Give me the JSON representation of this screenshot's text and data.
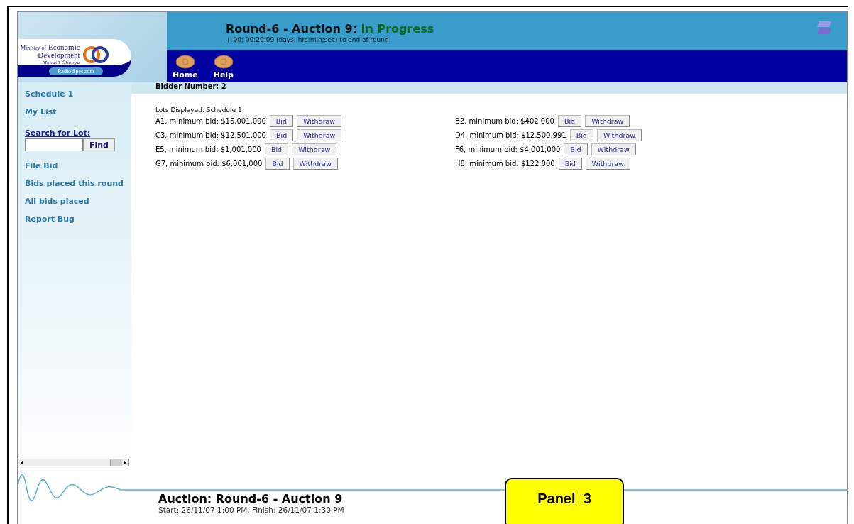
{
  "logo": {
    "ministry": "Ministry of",
    "name_line1": "Economic",
    "name_line2": "Development",
    "maori": "Manatū Ōhanga",
    "unit": "Radio Spectrum"
  },
  "header": {
    "title": "Round-6 - Auction 9:",
    "status": "In Progress",
    "countdown": "+ 00; 00:20:09 (days; hrs:min;sec) to end of round"
  },
  "nav": [
    {
      "label": "Home"
    },
    {
      "label": "Help"
    }
  ],
  "bidder": "Bidder Number: 2",
  "sidebar": {
    "items": [
      {
        "kind": "link",
        "label": "Schedule 1"
      },
      {
        "kind": "link",
        "label": "My List"
      },
      {
        "kind": "search",
        "label": "Search for Lot:",
        "button": "Find"
      },
      {
        "kind": "link",
        "label": "File Bid"
      },
      {
        "kind": "link",
        "label": "Bids placed this round"
      },
      {
        "kind": "link",
        "label": "All bids placed"
      },
      {
        "kind": "link",
        "label": "Report Bug"
      }
    ]
  },
  "lots_heading": "Lots Displayed: Schedule 1",
  "lots": [
    {
      "label": "A1, minimum bid: $15,001,000",
      "bid": "Bid",
      "withdraw": "Withdraw"
    },
    {
      "label": "B2, minimum bid: $402,000",
      "bid": "Bid",
      "withdraw": "Withdraw"
    },
    {
      "label": "C3, minimum bid: $12,501,000",
      "bid": "Bid",
      "withdraw": "Withdraw"
    },
    {
      "label": "D4, minimum bid: $12,500,991",
      "bid": "Bid",
      "withdraw": "Withdraw"
    },
    {
      "label": "E5, minimum bid: $1,001,000",
      "bid": "Bid",
      "withdraw": "Withdraw"
    },
    {
      "label": "F6, minimum bid: $4,001,000",
      "bid": "Bid",
      "withdraw": "Withdraw"
    },
    {
      "label": "G7, minimum bid: $6,001,000",
      "bid": "Bid",
      "withdraw": "Withdraw"
    },
    {
      "label": "H8, minimum bid: $122,000",
      "bid": "Bid",
      "withdraw": "Withdraw"
    }
  ],
  "footer": {
    "title": "Auction: Round-6 - Auction 9",
    "times": "Start: 26/11/07 1:00 PM, Finish: 26/11/07 1:30 PM"
  },
  "callout": "Panel  3"
}
